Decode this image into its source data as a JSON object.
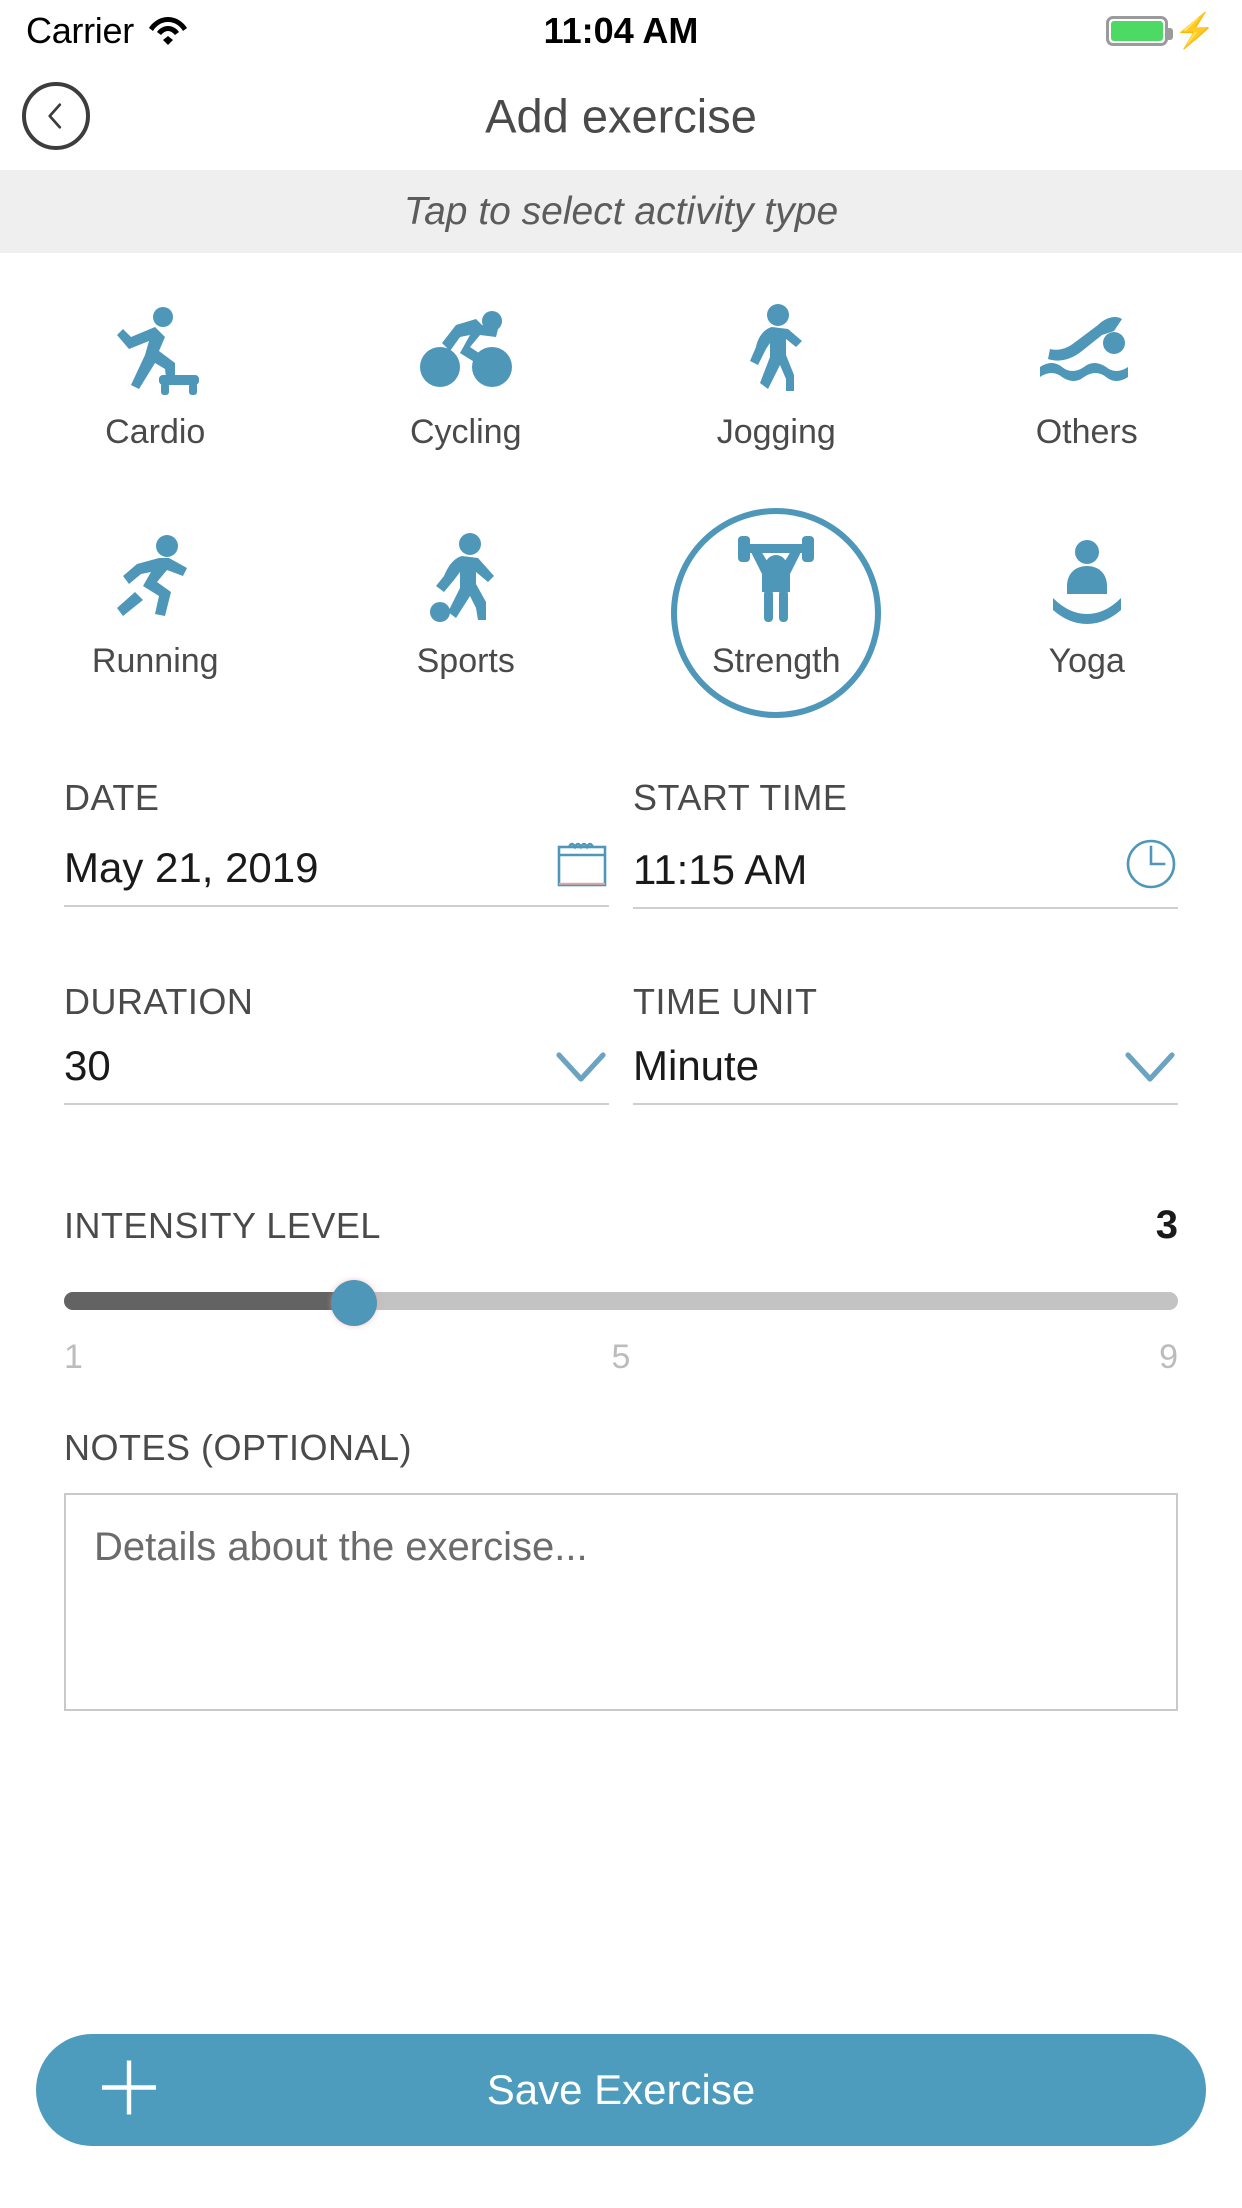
{
  "status_bar": {
    "carrier": "Carrier",
    "wifi_icon": "wifi-icon",
    "time": "11:04 AM",
    "battery_icon": "battery-full-icon",
    "charging_icon": "lightning-bolt-icon",
    "battery_color": "#4cd964"
  },
  "nav": {
    "back_icon": "chevron-left-circle-icon",
    "title": "Add exercise"
  },
  "banner": {
    "text": "Tap to select activity type"
  },
  "activities": {
    "selected": "Strength",
    "accent_color": "#4e97b9",
    "row1": [
      {
        "label": "Cardio",
        "icon": "cardio-icon"
      },
      {
        "label": "Cycling",
        "icon": "cycling-icon"
      },
      {
        "label": "Jogging",
        "icon": "jogging-icon"
      },
      {
        "label": "Others",
        "icon": "swimming-icon"
      }
    ],
    "row2": [
      {
        "label": "Running",
        "icon": "running-icon"
      },
      {
        "label": "Sports",
        "icon": "sports-icon"
      },
      {
        "label": "Strength",
        "icon": "weightlifting-icon"
      },
      {
        "label": "Yoga",
        "icon": "yoga-icon"
      }
    ]
  },
  "form": {
    "date": {
      "label": "DATE",
      "value": "May 21, 2019",
      "icon": "calendar-icon"
    },
    "start_time": {
      "label": "START TIME",
      "value": "11:15 AM",
      "icon": "clock-icon"
    },
    "duration": {
      "label": "DURATION",
      "value": "30",
      "icon": "chevron-down-icon"
    },
    "time_unit": {
      "label": "TIME UNIT",
      "value": "Minute",
      "icon": "chevron-down-icon"
    }
  },
  "intensity": {
    "label": "INTENSITY LEVEL",
    "value": "3",
    "min_tick": "1",
    "mid_tick": "5",
    "max_tick": "9",
    "fill_percent": 26,
    "thumb_color": "#4e97b9",
    "fill_color": "#636363",
    "track_color": "#c3c3c3"
  },
  "notes": {
    "label": "NOTES (OPTIONAL)",
    "placeholder": "Details about the exercise..."
  },
  "save": {
    "label": "Save Exercise",
    "icon": "plus-icon",
    "color": "#4e9cbd"
  }
}
